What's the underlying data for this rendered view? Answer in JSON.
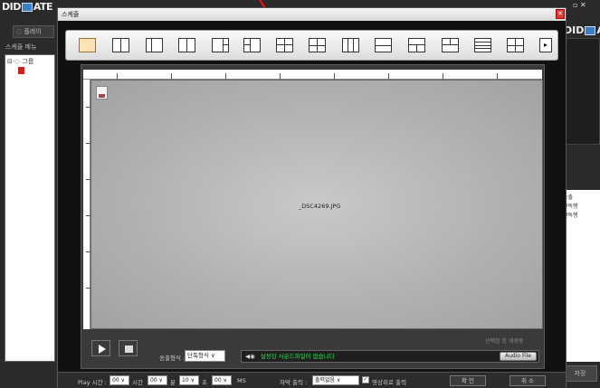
{
  "background_app": {
    "logo_left_pre": "DID",
    "logo_left_post": "ATE",
    "tab_label": "◌ 플레이",
    "menu_label": "스케쥴 메뉴",
    "tree_root": "⊟·◌ 그룹",
    "logo_right_pre": "DID",
    "logo_right_post": "AT",
    "right_panel_rows": [
      "송출",
      "단독행",
      "단독행"
    ],
    "right_button": "저장",
    "window_controls": "▫ ✕"
  },
  "dialog": {
    "title": "스케쥴",
    "close_glyph": "✕"
  },
  "layout_bar": {
    "items": [
      "layout-single",
      "layout-2col",
      "layout-2col-b",
      "layout-2col-c",
      "layout-2x1-right",
      "layout-left-split",
      "layout-grid-4",
      "layout-grid-4b",
      "layout-3col",
      "layout-2row",
      "layout-2row-b",
      "layout-top-split",
      "layout-4row",
      "layout-grid-2x2"
    ],
    "next_glyph": "▸"
  },
  "preview": {
    "file_name": "_DSC4269.JPG",
    "corner_text": "선택된 창 재생중",
    "play_glyph": "play",
    "stop_glyph": "stop"
  },
  "controls": {
    "mode_label": "송출형식 :",
    "mode_value": "단독형식  ∨",
    "audio_icon": "◀◉",
    "audio_message": "설정된 사운드파일이 없습니다",
    "audio_button": "Audio File"
  },
  "bottom": {
    "play_time_label": "Play 시간 :",
    "days_value": "00  ∨",
    "hours_label": "시간",
    "hours_value": "00  ∨",
    "minutes_label": "분",
    "minutes_value": "10  ∨",
    "seconds_label": "초",
    "seconds_value": "00  ∨",
    "ms_label": "MS",
    "music_label": "자막 출력 :",
    "music_value": "출력없음       ∨",
    "checkbox_glyph": "✓",
    "checkbox_label": "영상위로 출력",
    "ok_button": "확 인",
    "cancel_button": "취 소"
  }
}
